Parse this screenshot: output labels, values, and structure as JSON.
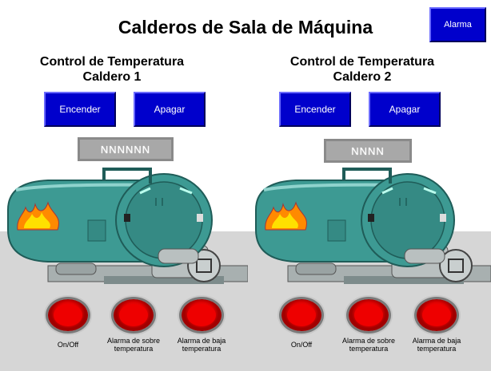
{
  "title": "Calderos de Sala de Máquina",
  "alarm_button": "Alarma",
  "boilers": [
    {
      "header_line1": "Control de Temperatura",
      "header_line2": "Caldero 1",
      "on_label": "Encender",
      "off_label": "Apagar",
      "display_value": "NNNNNN",
      "indicators": [
        "On/Off",
        "Alarma de sobre temperatura",
        "Alarma de baja temperatura"
      ]
    },
    {
      "header_line1": "Control de Temperatura",
      "header_line2": "Caldero 2",
      "on_label": "Encender",
      "off_label": "Apagar",
      "display_value": "NNNN",
      "indicators": [
        "On/Off",
        "Alarma de sobre temperatura",
        "Alarma de baja temperatura"
      ]
    }
  ],
  "colors": {
    "button_blue": "#0000cc",
    "boiler_teal": "#2f8f8a",
    "lamp_red": "#e00000",
    "floor_gray": "#d6d6d6"
  }
}
